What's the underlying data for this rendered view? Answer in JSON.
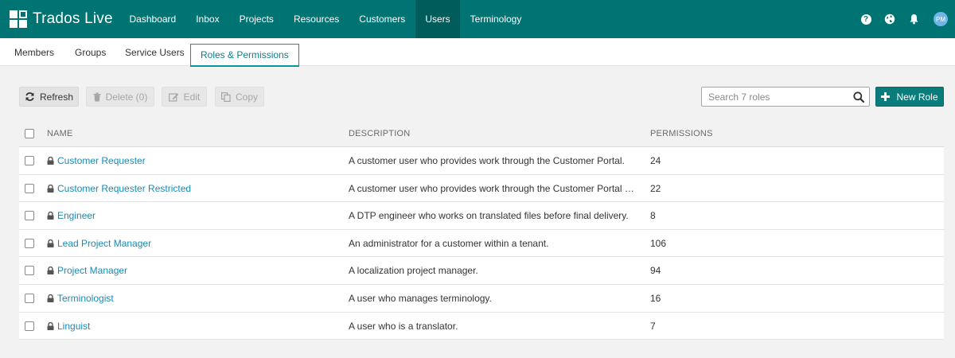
{
  "app": {
    "name": "Trados Live"
  },
  "nav": {
    "items": [
      "Dashboard",
      "Inbox",
      "Projects",
      "Resources",
      "Customers",
      "Users",
      "Terminology"
    ],
    "active_index": 5,
    "avatar_initials": "PM"
  },
  "icons": {
    "help": "help-circle-icon",
    "globe": "globe-icon",
    "bell": "bell-icon",
    "search": "search-icon",
    "refresh": "refresh-icon",
    "delete": "trash-icon",
    "edit": "edit-icon",
    "copy": "copy-icon",
    "add": "plus-icon",
    "lock": "lock-icon"
  },
  "subtabs": {
    "items": [
      "Members",
      "Groups",
      "Service Users",
      "Roles & Permissions"
    ],
    "active_index": 3
  },
  "toolbar": {
    "refresh_label": "Refresh",
    "delete_label": "Delete (0)",
    "edit_label": "Edit",
    "copy_label": "Copy",
    "new_role_label": "New Role",
    "search_placeholder": "Search 7 roles",
    "search_value": ""
  },
  "table": {
    "headers": {
      "name": "NAME",
      "description": "DESCRIPTION",
      "permissions": "PERMISSIONS"
    },
    "rows": [
      {
        "name": "Customer Requester",
        "description": "A customer user who provides work through the Customer Portal.",
        "permissions": "24"
      },
      {
        "name": "Customer Requester Restricted",
        "description": "A customer user who provides work through the Customer Portal but is n...",
        "permissions": "22"
      },
      {
        "name": "Engineer",
        "description": "A DTP engineer who works on translated files before final delivery.",
        "permissions": "8"
      },
      {
        "name": "Lead Project Manager",
        "description": "An administrator for a customer within a tenant.",
        "permissions": "106"
      },
      {
        "name": "Project Manager",
        "description": "A localization project manager.",
        "permissions": "94"
      },
      {
        "name": "Terminologist",
        "description": "A user who manages terminology.",
        "permissions": "16"
      },
      {
        "name": "Linguist",
        "description": "A user who is a translator.",
        "permissions": "7"
      }
    ]
  },
  "colors": {
    "brand": "#007373",
    "nav_active": "#005b5b",
    "link": "#1a8ab5",
    "primary_button": "#0a7c7c",
    "avatar": "#6fb5e6"
  }
}
